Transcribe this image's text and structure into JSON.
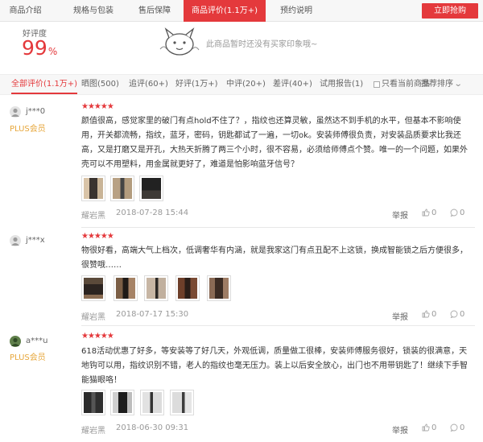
{
  "tabs": [
    {
      "label": "商品介绍"
    },
    {
      "label": "规格与包装"
    },
    {
      "label": "售后保障"
    },
    {
      "label": "商品评价(1.1万+)"
    },
    {
      "label": "预约说明"
    }
  ],
  "buy_button": "立即抢购",
  "rating": {
    "label": "好评度",
    "value": "99",
    "unit": "%"
  },
  "no_impression": "此商品暂时还没有买家印象哦~",
  "filters": [
    {
      "label": "全部评价(1.1万+)"
    },
    {
      "label": "晒图(500)"
    },
    {
      "label": "追评(60+)"
    },
    {
      "label": "好评(1万+)"
    },
    {
      "label": "中评(20+)"
    },
    {
      "label": "差评(40+)"
    },
    {
      "label": "试用报告(1)"
    }
  ],
  "only_current": "只看当前商品",
  "sort_label": "推荐排序",
  "colors": {
    "brand_red": "#e4393c",
    "plus_gold": "#e7a73c"
  },
  "reviews": [
    {
      "user": "j***0",
      "badge": "PLUS会员",
      "stars": "★★★★★",
      "content": "颜值很高，感觉家里的破门有点hold不住了？，指纹也还算灵敏，虽然达不到手机的水平，但基本不影响使用，开关都流畅，指纹，蓝牙，密码，钥匙都试了一遍，一切ok。安装师傅很负责，对安装品质要求比我还高，又是打磨又是开孔，大热天折腾了两三个小时，很不容易，必须给师傅点个赞。唯一的一个问题，如果外壳可以不用塑料，用金属就更好了，难道是怕影响蓝牙信号？",
      "color": "耀岩黑",
      "time": "2018-07-28 15:44",
      "report": "举报",
      "likes": "0",
      "comments": "0"
    },
    {
      "user": "j***x",
      "badge": "",
      "stars": "★★★★★",
      "content": "物很好看，高端大气上档次，低调奢华有内涵，就是我家这门有点丑配不上这锁，换成智能锁之后方便很多，很赞哦……",
      "color": "耀岩黑",
      "time": "2018-07-17 15:30",
      "report": "举报",
      "likes": "0",
      "comments": "0"
    },
    {
      "user": "a***u",
      "badge": "PLUS会员",
      "stars": "★★★★★",
      "content": "618活动优惠了好多，等安装等了好几天，外观低调，质量做工很棒，安装师傅服务很好，锁装的很满意，天地钩可以用，指纹识别不错，老人的指纹也毫无压力。装上以后安全放心，出门也不用带钥匙了！继续下手智能猫眼咯！",
      "color": "耀岩黑",
      "time": "2018-06-30 09:31",
      "report": "举报",
      "likes": "0",
      "comments": "0"
    }
  ]
}
